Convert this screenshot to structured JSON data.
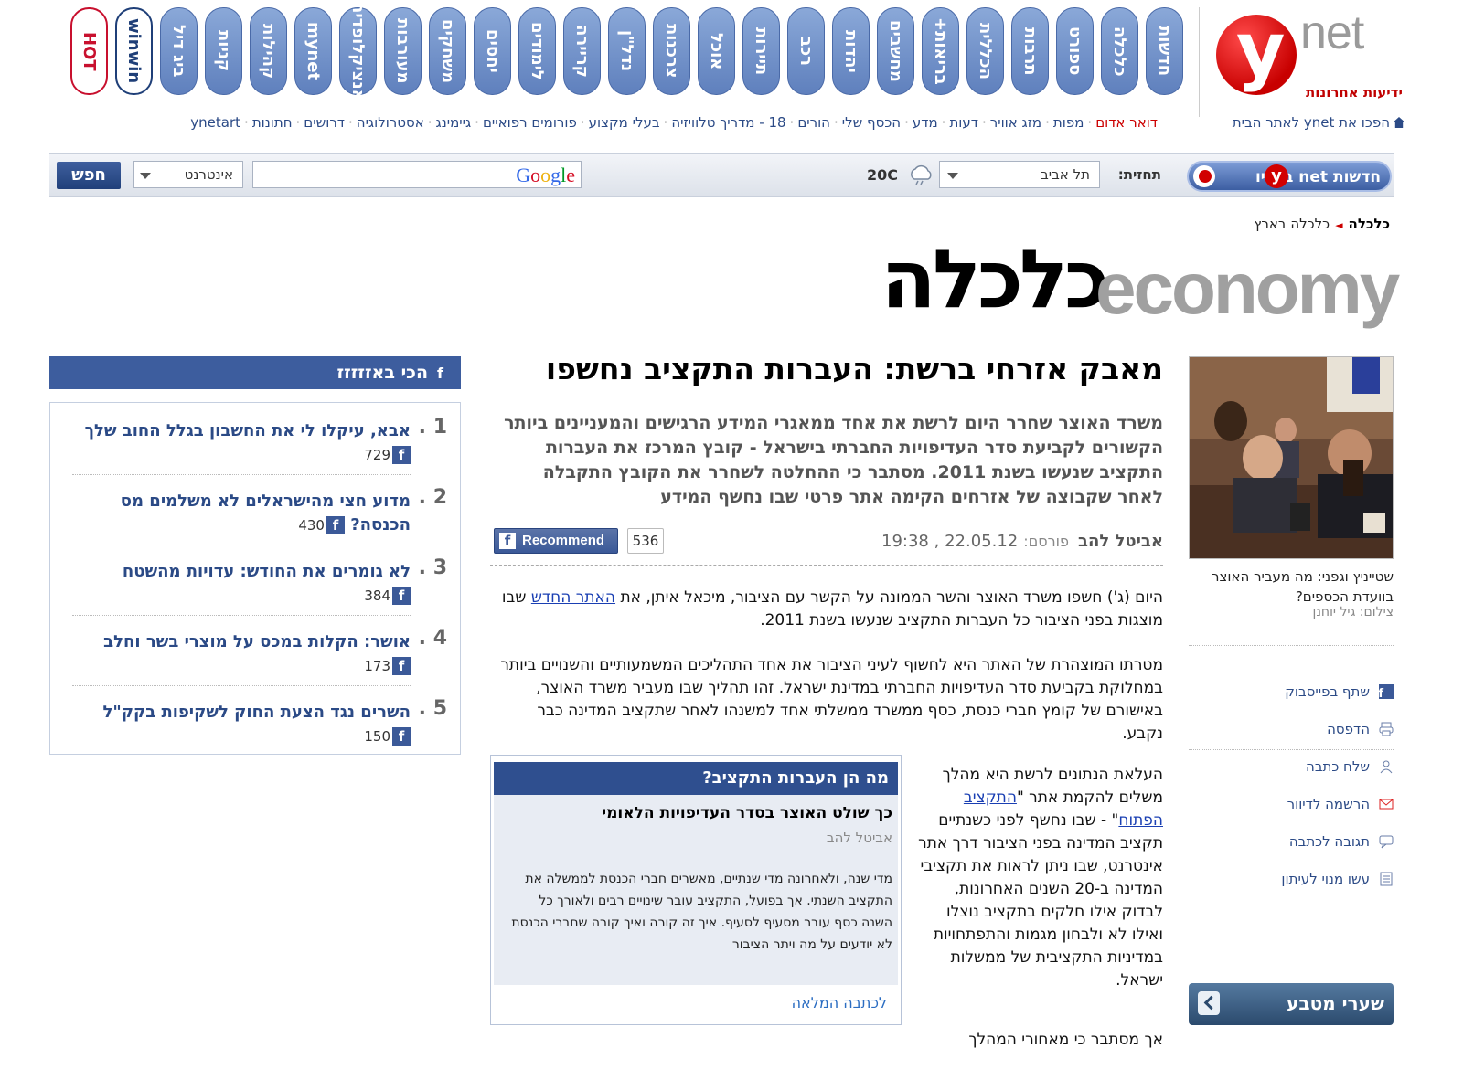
{
  "logo": {
    "letter": "y",
    "word": "net",
    "subtitle": "ידיעות אחרונות"
  },
  "tabs": [
    {
      "label": "חדשות",
      "style": "blue"
    },
    {
      "label": "כלכלה",
      "style": "blue"
    },
    {
      "label": "ספורט",
      "style": "blue"
    },
    {
      "label": "תרבות",
      "style": "blue"
    },
    {
      "label": "הכללית",
      "style": "blue"
    },
    {
      "label": "בריאות+",
      "style": "blue"
    },
    {
      "label": "מחשבים",
      "style": "blue"
    },
    {
      "label": "יהדות",
      "style": "blue"
    },
    {
      "label": "רכב",
      "style": "blue"
    },
    {
      "label": "תיירות",
      "style": "blue"
    },
    {
      "label": "אוכל",
      "style": "blue"
    },
    {
      "label": "צרכנות",
      "style": "blue"
    },
    {
      "label": "נדל\"ן",
      "style": "blue"
    },
    {
      "label": "קריירה",
      "style": "blue"
    },
    {
      "label": "לימודים",
      "style": "blue"
    },
    {
      "label": "יחסים",
      "style": "blue"
    },
    {
      "label": "משחקים",
      "style": "blue"
    },
    {
      "label": "מעורבות",
      "style": "blue"
    },
    {
      "label": "אנציקלופדיה",
      "style": "blue"
    },
    {
      "label": "mynet",
      "style": "blue"
    },
    {
      "label": "קהילות",
      "style": "blue"
    },
    {
      "label": "קניות",
      "style": "blue"
    },
    {
      "label": "ביג דיל",
      "style": "blue"
    },
    {
      "label": "winwin",
      "style": "white-blue"
    },
    {
      "label": "HOT",
      "style": "white-red"
    }
  ],
  "home_link": "הפכו את ynet לאתר הבית",
  "top_links": [
    {
      "label": "דואר אדום",
      "red": true
    },
    {
      "label": "מפות"
    },
    {
      "label": "מזג אוויר"
    },
    {
      "label": "דעות"
    },
    {
      "label": "מדע"
    },
    {
      "label": "הכסף שלי"
    },
    {
      "label": "הורים"
    },
    {
      "label": "18 - מדריך טלוויזיה"
    },
    {
      "label": "בעלי מקצוע"
    },
    {
      "label": "פורומים רפואיים"
    },
    {
      "label": "גיימינג"
    },
    {
      "label": "אסטרולוגיה"
    },
    {
      "label": "דרושים"
    },
    {
      "label": "חתונות"
    },
    {
      "label": "ynetart"
    }
  ],
  "searchbar": {
    "radio_label": "חדשות net ברדיו",
    "radio_y": "y",
    "forecast_label": "תחזית:",
    "city": "תל אביב",
    "temperature": "20C",
    "google": "Google",
    "engine": "אינטרנט",
    "search_button": "חפש"
  },
  "breadcrumb": {
    "section": "כלכלה",
    "sub": "כלכלה בארץ"
  },
  "section_title": {
    "hebrew": "כלכלה",
    "english": "economy"
  },
  "buzz": {
    "title": "הכי באזזזזז",
    "items": [
      {
        "num": "1 .",
        "title": "אבא, עיקלו לי את החשבון בגלל החוב שלך",
        "count": "729"
      },
      {
        "num": "2 .",
        "title": "מדוע חצי מהישראלים לא משלמים מס הכנסה?",
        "count": "430"
      },
      {
        "num": "3 .",
        "title": "לא גומרים את החודש: עדויות מהשטח",
        "count": "384"
      },
      {
        "num": "4 .",
        "title": "אושר: הקלות במכס על מוצרי בשר וחלב",
        "count": "173"
      },
      {
        "num": "5 .",
        "title": "השרים נגד הצעת החוק לשקיפות בקק\"ל",
        "count": "150"
      }
    ]
  },
  "article": {
    "headline": "מאבק אזרחי ברשת: העברות התקציב נחשפו",
    "summary": "משרד האוצר שחרר היום לרשת את אחד ממאגרי המידע הרגישים והמעניינים ביותר הקשורים לקביעת סדר העדיפויות החברתי בישראל - קובץ המרכז את העברות התקציב שנעשו בשנת 2011. מסתבר כי ההחלטה לשחרר את הקובץ התקבלה לאחר שקבוצה של אזרחים הקימה אתר פרטי שבו נחשף המידע",
    "author": "אביטל להב",
    "posted_label": "פורסם:",
    "date": "22.05.12",
    "time": "19:38",
    "recommend_label": "Recommend",
    "recommend_count": "536",
    "p1_a": "היום (ג') חשפו משרד האוצר והשר הממונה על הקשר עם הציבור, מיכאל איתן, את",
    "p1_link": "האתר החדש",
    "p1_b": "שבו מוצגות בפני הציבור כל העברות התקציב שנעשו בשנת 2011.",
    "p2": "מטרתו המוצהרת של האתר היא לחשוף לעיני הציבור את אחד התהליכים המשמעותיים והשנויים ביותר במחלוקת בקביעת סדר העדיפויות החברתי במדינת ישראל. זהו תהליך שבו מעביר משרד האוצר, באישורם של קומץ חברי כנסת, כסף ממשרד ממשלתי אחד למשנהו לאחר שתקציב המדינה כבר נקבע.",
    "p3_a": "העלאת הנתונים לרשת היא מהלך משלים להקמת אתר \"",
    "p3_link": "התקציב הפתוח",
    "p3_b": "\" - שבו נחשף לפני כשנתיים תקציב המדינה בפני הציבור דרך אתר אינטרנט, שבו ניתן לראות את תקציבי המדינה ב-20 השנים האחרונות, לבדוק אילו חלקים בתקציב נוצלו ואילו לא ולבחון מגמות והתפתחויות במדיניות התקציבית של ממשלות ישראל.",
    "p4": "אך מסתבר כי מאחורי המהלך"
  },
  "sidebox": {
    "title": "מה הן העברות התקציב?",
    "subtitle": "כך שולט האוצר בסדר העדיפויות הלאומי",
    "author": "אביטל להב",
    "text": "מדי שנה, ולאחרונה מדי שנתיים, מאשרים חברי הכנסת לממשלה את התקציב השנתי. אך בפועל, התקציב עובר שינויים רבים ולאורך כל השנה כסף עובר מסעיף לסעיף. איך זה קורה ואיך קורה שחברי הכנסת לא יודעים על מה ויתר הציבור",
    "link": "לכתבה המלאה"
  },
  "photo": {
    "caption": "שטייניץ וגפני: מה מעביר האוצר בוועדת הכספים?",
    "credit": "צילום: גיל יוחנן"
  },
  "tools": [
    {
      "label": "שתף בפייסבוק",
      "icon": "facebook-icon"
    },
    {
      "label": "הדפסה",
      "icon": "print-icon"
    },
    {
      "label": "שלח כתבה",
      "icon": "send-icon"
    },
    {
      "label": "הרשמה לדיוור",
      "icon": "mail-icon"
    },
    {
      "label": "תגובה לכתבה",
      "icon": "comment-icon"
    },
    {
      "label": "עשו מנוי לעיתון",
      "icon": "newspaper-icon"
    }
  ],
  "promo": {
    "title": "שערי מטבע"
  },
  "colors": {
    "brand_red": "#c80000",
    "nav_blue": "#3d5d9e",
    "link_blue": "#2b4a86"
  }
}
